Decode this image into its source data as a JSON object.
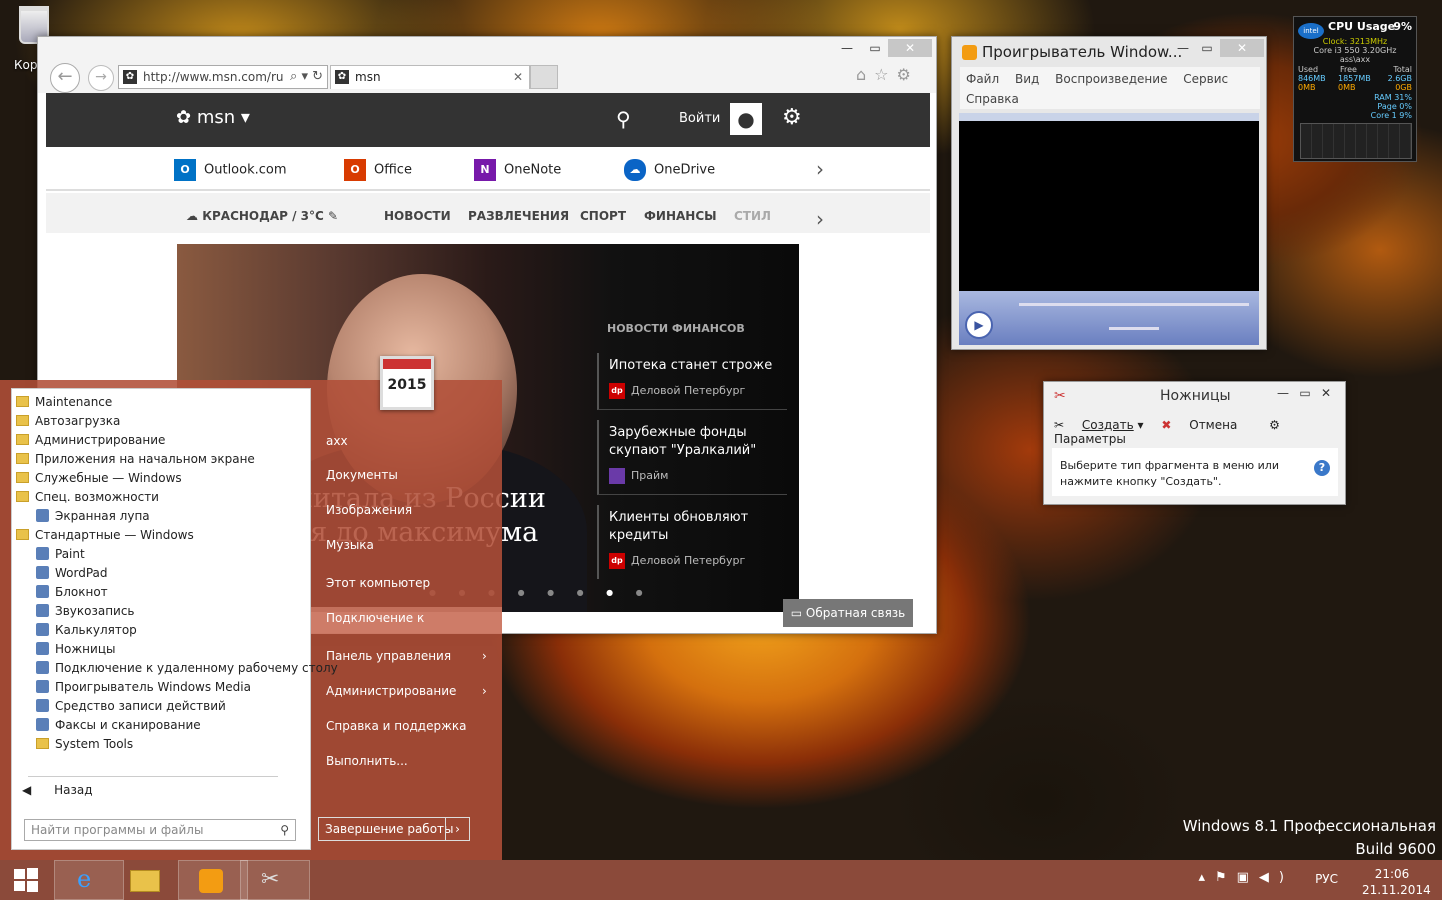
{
  "desktop": {
    "recycle_label": "Кор",
    "watermark_line1": "Windows 8.1 Профессиональная",
    "watermark_line2": "Build 9600"
  },
  "ie": {
    "address": "http://www.msn.com/ru",
    "tab_title": "msn",
    "msn": {
      "logo": "msn",
      "login": "Войти"
    },
    "apps": [
      {
        "label": "Outlook.com",
        "color": "#0072c6"
      },
      {
        "label": "Office",
        "color": "#d83b01"
      },
      {
        "label": "OneNote",
        "color": "#7719aa"
      },
      {
        "label": "OneDrive",
        "color": "#0a64c6"
      }
    ],
    "categories": [
      "КРАСНОДАР / 3°C",
      "НОВОСТИ",
      "РАЗВЛЕЧЕНИЯ",
      "СПОРТ",
      "ФИНАНСЫ",
      "СТИЛ"
    ],
    "hero_title_line1": "питала из России",
    "hero_title_line2": "ся до максимума",
    "news_heading": "НОВОСТИ ФИНАНСОВ",
    "news": [
      {
        "title": "Ипотека станет строже",
        "source": "Деловой Петербург",
        "badge": "dp"
      },
      {
        "title": "Зарубежные фонды скупают \"Уралкалий\"",
        "source": "Прайм",
        "badge": ""
      },
      {
        "title": "Клиенты обновляют кредиты",
        "source": "Деловой Петербург",
        "badge": "dp"
      }
    ],
    "feedback": "Обратная связь"
  },
  "wmp": {
    "title": "Проигрыватель Window...",
    "menu": [
      "Файл",
      "Вид",
      "Воспроизведение",
      "Сервис",
      "Справка"
    ]
  },
  "gadget": {
    "title": "CPU Usage",
    "percent": "9%",
    "clock": "Clock: 3213MHz",
    "cpu": "Core i3 550 3.20GHz",
    "user": "ass\\axx",
    "headers": [
      "Used",
      "Free",
      "Total"
    ],
    "mem_mb": [
      "846MB",
      "1857MB",
      "2.6GB"
    ],
    "mem_gb": [
      "0MB",
      "0MB",
      "0GB"
    ],
    "ram": "RAM 31%",
    "page": "Page 0%",
    "core": "Core 1 9%"
  },
  "snip": {
    "title": "Ножницы",
    "create": "Создать",
    "cancel": "Отмена",
    "options": "Параметры",
    "message": "Выберите тип фрагмента в меню или нажмите кнопку \"Создать\"."
  },
  "startmenu": {
    "items": [
      {
        "label": "Maintenance",
        "type": "folder",
        "sub": false
      },
      {
        "label": "Автозагрузка",
        "type": "folder",
        "sub": false
      },
      {
        "label": "Администрирование",
        "type": "folder",
        "sub": false
      },
      {
        "label": "Приложения на начальном экране",
        "type": "folder",
        "sub": false
      },
      {
        "label": "Служебные — Windows",
        "type": "folder",
        "sub": false
      },
      {
        "label": "Спец. возможности",
        "type": "folder",
        "sub": false
      },
      {
        "label": "Экранная лупа",
        "type": "program",
        "sub": true
      },
      {
        "label": "Стандартные — Windows",
        "type": "folder",
        "sub": false
      },
      {
        "label": "Paint",
        "type": "program",
        "sub": true
      },
      {
        "label": "WordPad",
        "type": "program",
        "sub": true
      },
      {
        "label": "Блокнот",
        "type": "program",
        "sub": true
      },
      {
        "label": "Звукозапись",
        "type": "program",
        "sub": true
      },
      {
        "label": "Калькулятор",
        "type": "program",
        "sub": true
      },
      {
        "label": "Ножницы",
        "type": "program",
        "sub": true
      },
      {
        "label": "Подключение к удаленному рабочему столу",
        "type": "program",
        "sub": true
      },
      {
        "label": "Проигрыватель Windows Media",
        "type": "program",
        "sub": true
      },
      {
        "label": "Средство записи действий",
        "type": "program",
        "sub": true
      },
      {
        "label": "Факсы и сканирование",
        "type": "program",
        "sub": true
      },
      {
        "label": "System Tools",
        "type": "folder",
        "sub": true
      }
    ],
    "back": "Назад",
    "search_placeholder": "Найти программы и файлы",
    "right_items": [
      {
        "label": "axx",
        "arrow": false
      },
      {
        "label": "Документы",
        "arrow": false
      },
      {
        "label": "Изображения",
        "arrow": false
      },
      {
        "label": "Музыка",
        "arrow": false
      },
      {
        "label": "Этот компьютер",
        "arrow": false
      },
      {
        "label": "Подключение к",
        "arrow": false
      },
      {
        "label": "Панель управления",
        "arrow": true
      },
      {
        "label": "Администрирование",
        "arrow": true
      },
      {
        "label": "Справка и поддержка",
        "arrow": false
      },
      {
        "label": "Выполнить...",
        "arrow": false
      }
    ],
    "calendar_year": "2015",
    "shutdown": "Завершение работы"
  },
  "taskbar": {
    "lang": "РУС",
    "time": "21:06",
    "date": "21.11.2014"
  }
}
